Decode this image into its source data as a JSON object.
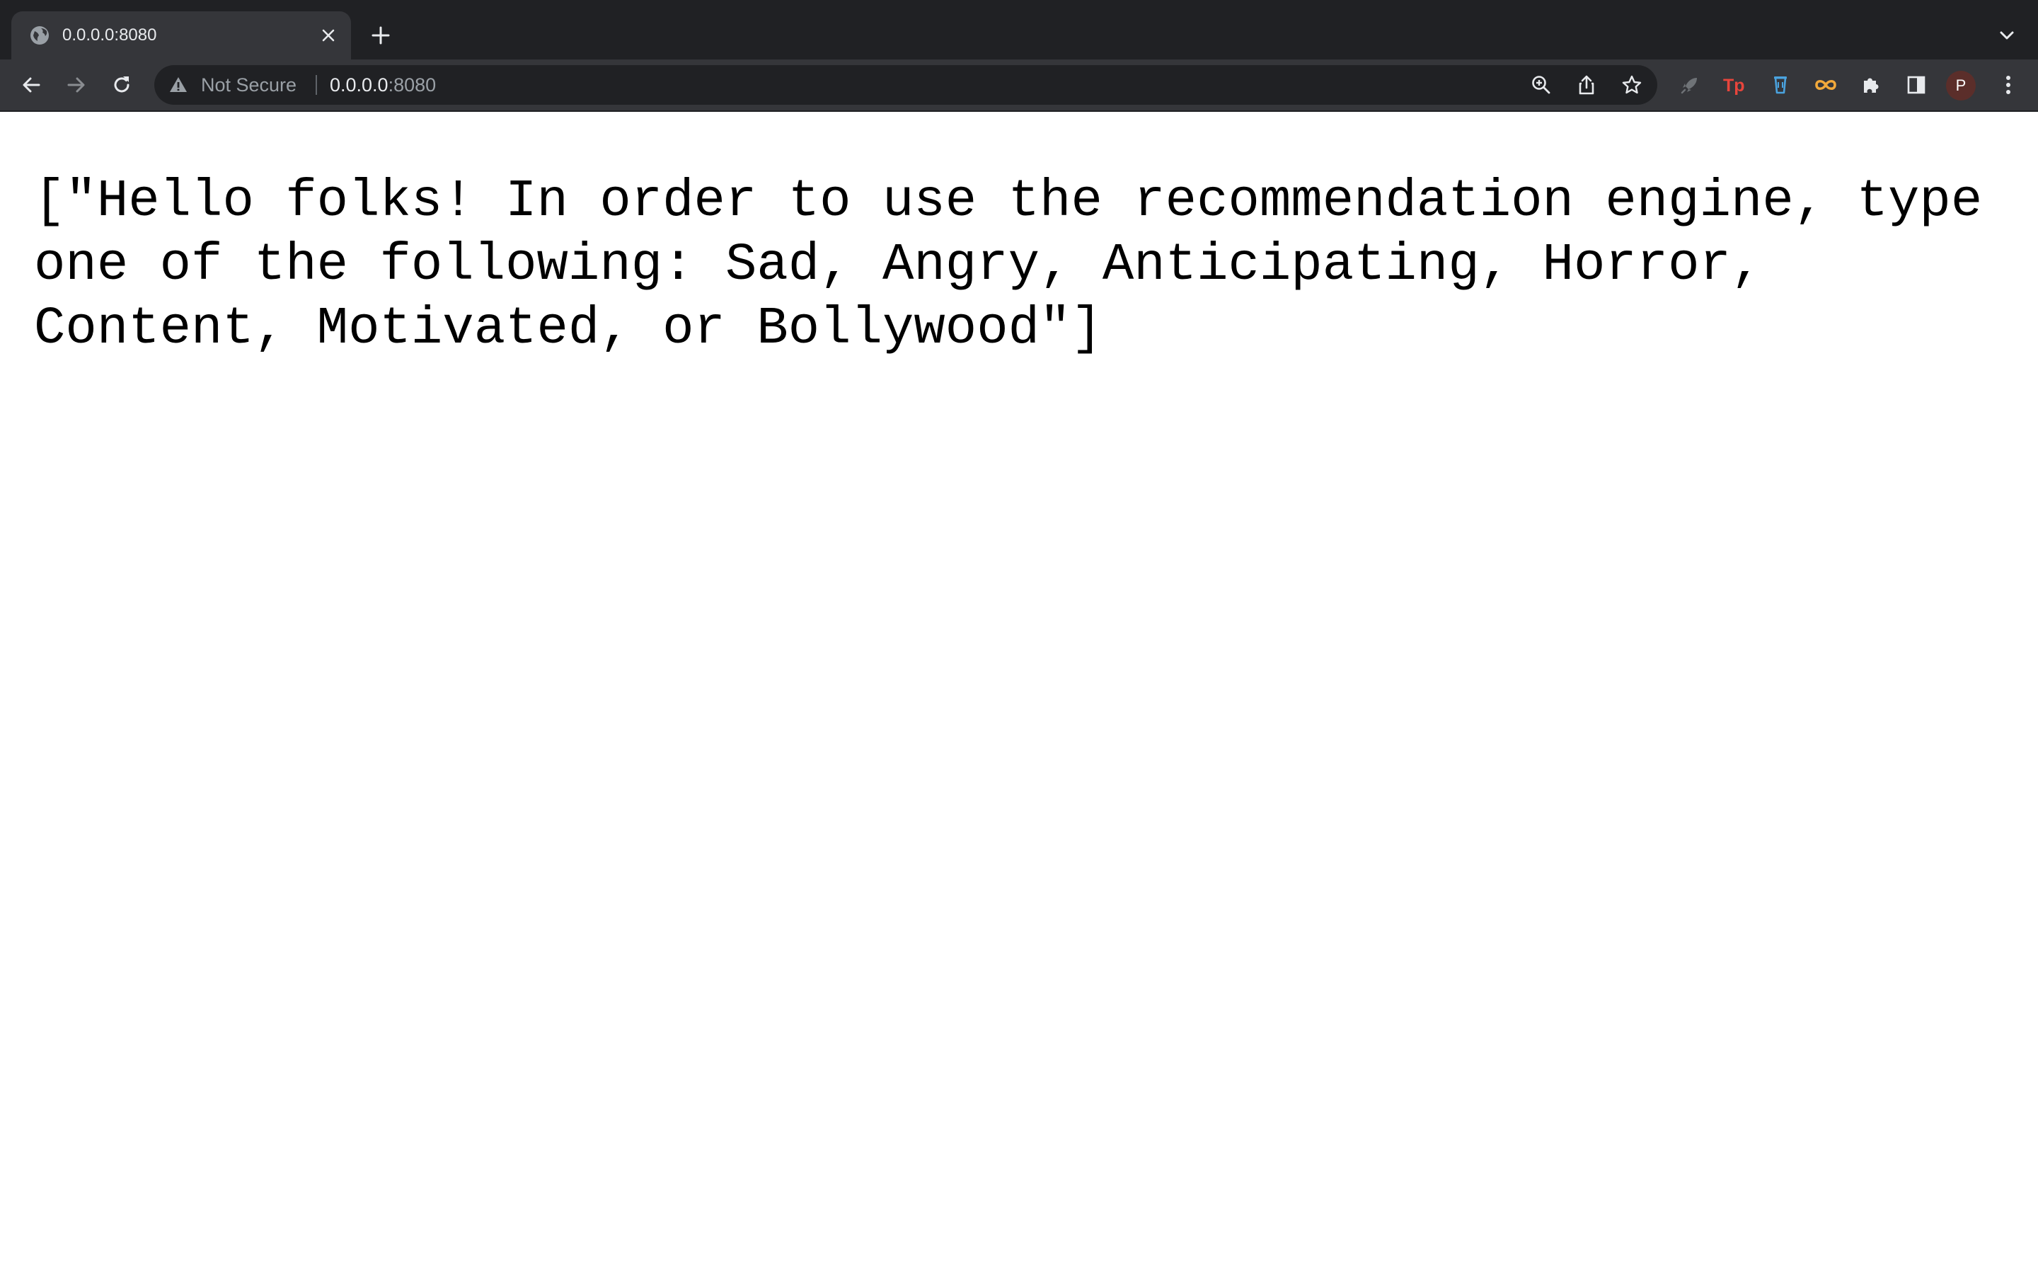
{
  "browser": {
    "tab": {
      "title": "0.0.0.0:8080",
      "favicon": "globe-icon",
      "close_icon": "close-icon"
    },
    "new_tab_icon": "plus-icon",
    "tab_search_icon": "chevron-down-icon",
    "nav": {
      "back_icon": "back-arrow-icon",
      "forward_icon": "forward-arrow-icon",
      "reload_icon": "reload-icon"
    },
    "omnibox": {
      "security_icon": "warning-triangle-icon",
      "security_label": "Not Secure",
      "url_host": "0.0.0.0",
      "url_port": ":8080",
      "zoom_icon": "zoom-icon",
      "share_icon": "share-icon",
      "bookmark_icon": "star-icon"
    },
    "extensions": [
      {
        "name": "rocket-extension-icon"
      },
      {
        "name": "tp-extension-icon",
        "label": "Tp"
      },
      {
        "name": "cup-extension-icon"
      },
      {
        "name": "infinity-extension-icon"
      },
      {
        "name": "puzzle-extensions-icon"
      }
    ],
    "side_panel_icon": "side-panel-icon",
    "profile_initial": "P",
    "menu_icon": "kebab-menu-icon",
    "colors": {
      "tabstrip": "#202124",
      "toolbar": "#35363a",
      "omnibox": "#202124",
      "tp_red": "#e8453c",
      "cup_blue": "#4aa3df",
      "infinity_orange": "#f2a93b",
      "avatar": "#5b2e2a"
    }
  },
  "page": {
    "text": "[\"Hello folks! In order to use the recommendation engine, type one of the following: Sad, Angry, Anticipating, Horror, Content, Motivated, or Bollywood\"]"
  }
}
